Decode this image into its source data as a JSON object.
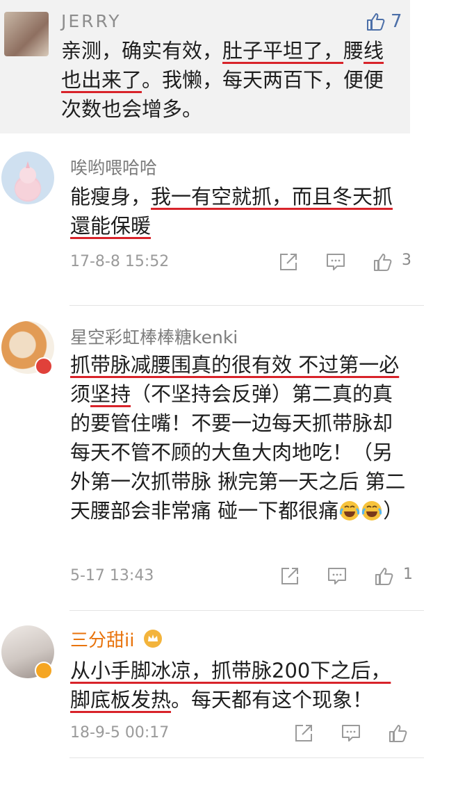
{
  "comments": [
    {
      "user": "JERRY",
      "text": [
        {
          "t": "亲测，确实有效，"
        },
        {
          "t": "肚子平坦了，",
          "u": true
        },
        {
          "t": "腰"
        },
        {
          "t": "线也出来了",
          "u": true
        },
        {
          "t": "。我懒，每天两百下，便便次数也会增多。"
        }
      ],
      "likes": "7",
      "like_color": "#4c6fa8"
    },
    {
      "user": "唉哟喂哈哈",
      "text": [
        {
          "t": "能瘦身，"
        },
        {
          "t": "我一有空就抓，而且冬天抓",
          "u": true
        },
        {
          "t": "還能保暖",
          "u": true
        }
      ],
      "time": "17-8-8 15:52",
      "likes": "3"
    },
    {
      "user": "星空彩虹棒棒糖kenki",
      "text": [
        {
          "t": "抓带脉减腰围真的很有效 不过第一必",
          "u": true
        },
        {
          "t": "须"
        },
        {
          "t": "坚持",
          "u": true
        },
        {
          "t": "（不坚持会反弹）第二真的真的要管住嘴！不要一边每天抓带脉却每天不管不顾的大鱼大肉地吃！（另外第一次抓带脉 揪完第一天之后 第二天腰部会非常痛 碰一下都很痛"
        },
        {
          "emoji": "crying-laughing-emoji"
        },
        {
          "emoji": "crying-laughing-emoji"
        },
        {
          "t": "）"
        }
      ],
      "time": "5-17 13:43",
      "likes": "1"
    },
    {
      "user": "三分甜ii",
      "user_color": "#e8730c",
      "text": [
        {
          "t": "从小手脚冰凉，抓带脉200下之后，",
          "u": true
        },
        {
          "t": "脚底板发热",
          "u": true
        },
        {
          "t": "。每天都有这个现象！"
        }
      ],
      "time": "18-9-5 00:17",
      "likes": ""
    }
  ],
  "colors": {
    "underline": "#d8232a",
    "verified_badge": "#f5a623",
    "red_badge": "#e0413a",
    "crown": "#f3b43c"
  },
  "icons": [
    "share-icon",
    "comment-icon",
    "thumbs-up-icon"
  ]
}
